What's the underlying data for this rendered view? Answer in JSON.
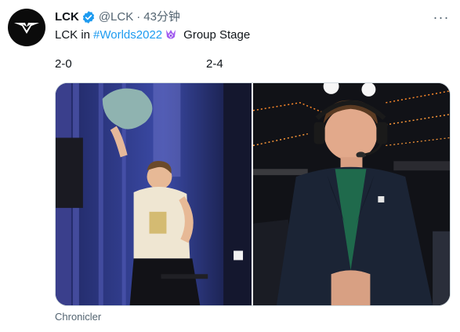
{
  "tweet": {
    "author_name": "LCK",
    "author_handle": "@LCK",
    "separator": "·",
    "timestamp": "43分钟",
    "text_before": "LCK in",
    "hashtag": "#Worlds2022",
    "text_after": "Group Stage",
    "score_left": "2-0",
    "score_right": "2-4",
    "media_caption": "Chronicler",
    "more_label": "···"
  },
  "colors": {
    "link": "#1d9bf0",
    "verified": "#1d9bf0",
    "secondary_text": "#536471",
    "primary_text": "#0f1419"
  },
  "icons": {
    "avatar": "lck-logo-icon",
    "verified": "verified-badge-icon",
    "more": "more-options-icon",
    "emoji": "worlds-trophy-emoji-icon"
  }
}
